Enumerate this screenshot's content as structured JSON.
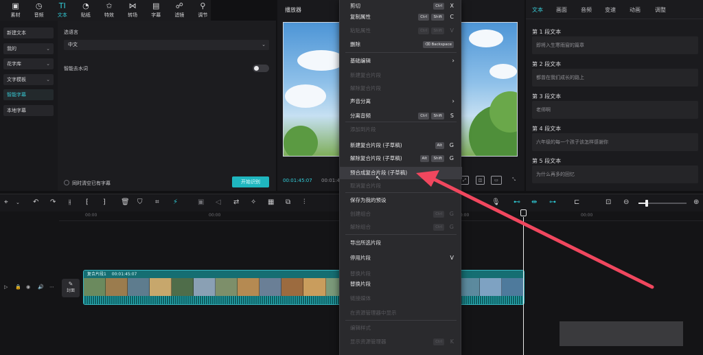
{
  "toolbar": {
    "items": [
      {
        "label": "素材",
        "icon": "media-icon"
      },
      {
        "label": "音频",
        "icon": "audio-icon"
      },
      {
        "label": "文本",
        "icon": "text-icon",
        "active": true
      },
      {
        "label": "贴纸",
        "icon": "sticker-icon"
      },
      {
        "label": "特效",
        "icon": "effects-icon"
      },
      {
        "label": "转场",
        "icon": "transition-icon"
      },
      {
        "label": "字幕",
        "icon": "caption-icon"
      },
      {
        "label": "滤镜",
        "icon": "filter-icon"
      },
      {
        "label": "调节",
        "icon": "adjust-icon"
      }
    ],
    "icon_glyphs": [
      "▣",
      "◷",
      "TI",
      "◔",
      "✩",
      "⋈",
      "▤",
      "☍",
      "⚲"
    ]
  },
  "left_nav": {
    "items": [
      {
        "label": "新建文本",
        "has_chevron": false
      },
      {
        "label": "我的",
        "has_chevron": true
      },
      {
        "label": "花字库",
        "has_chevron": true
      },
      {
        "label": "文字模板",
        "has_chevron": true
      },
      {
        "label": "智能字幕",
        "has_chevron": false,
        "active": true
      },
      {
        "label": "本地字幕",
        "has_chevron": false
      }
    ]
  },
  "settings": {
    "language_label": "选语言",
    "language_value": "中文",
    "remove_filler_label": "智能去水词",
    "clear_existing_label": "同时清空已有字幕",
    "start_button": "开始识别"
  },
  "player": {
    "title": "播放器",
    "current_time": "00:01:45:07",
    "duration": "00:01:4"
  },
  "right_panel": {
    "tabs": [
      "文本",
      "画面",
      "音频",
      "变速",
      "动画",
      "调整"
    ],
    "active_tab": 0,
    "segments": [
      {
        "title": "第 1 段文本",
        "text": "即将入生寒雨窗的篇章"
      },
      {
        "title": "第 2 段文本",
        "text": "都曾在我们成长的路上"
      },
      {
        "title": "第 3 段文本",
        "text": "老师啊"
      },
      {
        "title": "第 4 段文本",
        "text": "六年级的每一个孩子该怎样感谢你"
      },
      {
        "title": "第 5 段文本",
        "text": "为什么再多的回忆"
      }
    ]
  },
  "timeline": {
    "ruler_labels": [
      "00:00",
      "00:00",
      "00:00",
      "00:00"
    ],
    "clip_label": "复合片段1",
    "clip_duration": "00:01:45:07",
    "cover_label": "封面"
  },
  "context_menu": {
    "items": [
      {
        "label": "剪切",
        "keys": [
          "Ctrl"
        ],
        "key": "X",
        "disabled": false
      },
      {
        "label": "复制属性",
        "keys": [
          "Ctrl",
          "Shift"
        ],
        "key": "C",
        "disabled": false
      },
      {
        "label": "粘贴属性",
        "keys": [
          "Ctrl",
          "Shift"
        ],
        "key": "V",
        "disabled": true
      },
      {
        "label": "删除",
        "keys": [
          "⌫ Backspace"
        ],
        "key": "",
        "disabled": false
      },
      {
        "label": "基础编辑",
        "keys": [],
        "key": "",
        "disabled": false,
        "submenu": true
      },
      {
        "label": "新建复合片段",
        "keys": [],
        "key": "",
        "disabled": true
      },
      {
        "label": "解除复合片段",
        "keys": [],
        "key": "",
        "disabled": true
      },
      {
        "label": "声音分离",
        "keys": [],
        "key": "",
        "disabled": false,
        "submenu": true
      },
      {
        "label": "分离音频",
        "keys": [
          "Ctrl",
          "Shift"
        ],
        "key": "S",
        "disabled": false
      },
      {
        "label": "添加到片段",
        "keys": [],
        "key": "",
        "disabled": true
      },
      {
        "label": "新建复合片段 (子草稿)",
        "keys": [
          "Alt"
        ],
        "key": "G",
        "disabled": false
      },
      {
        "label": "解除复合片段 (子草稿)",
        "keys": [
          "Alt",
          "Shift"
        ],
        "key": "G",
        "disabled": false
      },
      {
        "label": "预合成复合片段 (子草稿)",
        "keys": [],
        "key": "",
        "disabled": false,
        "highlighted": true
      },
      {
        "label": "取消复合片段",
        "keys": [],
        "key": "",
        "disabled": true
      },
      {
        "label": "保存为我的预设",
        "keys": [],
        "key": "",
        "disabled": false
      },
      {
        "label": "创建组合",
        "keys": [
          "Ctrl"
        ],
        "key": "G",
        "disabled": true
      },
      {
        "label": "解除组合",
        "keys": [
          "Ctrl"
        ],
        "key": "G",
        "disabled": true
      },
      {
        "label": "导出所选片段",
        "keys": [],
        "key": "",
        "disabled": false
      },
      {
        "label": "停用片段",
        "keys": [],
        "key": "V",
        "disabled": false
      },
      {
        "label": "替换片段",
        "keys": [],
        "key": "",
        "disabled": true
      },
      {
        "label": "替换片段",
        "keys": [],
        "key": "",
        "disabled": false
      },
      {
        "label": "链接媒体",
        "keys": [],
        "key": "",
        "disabled": true
      },
      {
        "label": "在资源管理器中显示",
        "keys": [],
        "key": "",
        "disabled": true
      },
      {
        "label": "编辑样式",
        "keys": [],
        "key": "",
        "disabled": true
      },
      {
        "label": "显示资源管理器",
        "keys": [
          "Ctrl"
        ],
        "key": "K",
        "disabled": true
      }
    ]
  },
  "colors": {
    "accent": "#33d0dc",
    "annotation_arrow": "#f0475e",
    "menu_bg": "#2a2a2d"
  }
}
